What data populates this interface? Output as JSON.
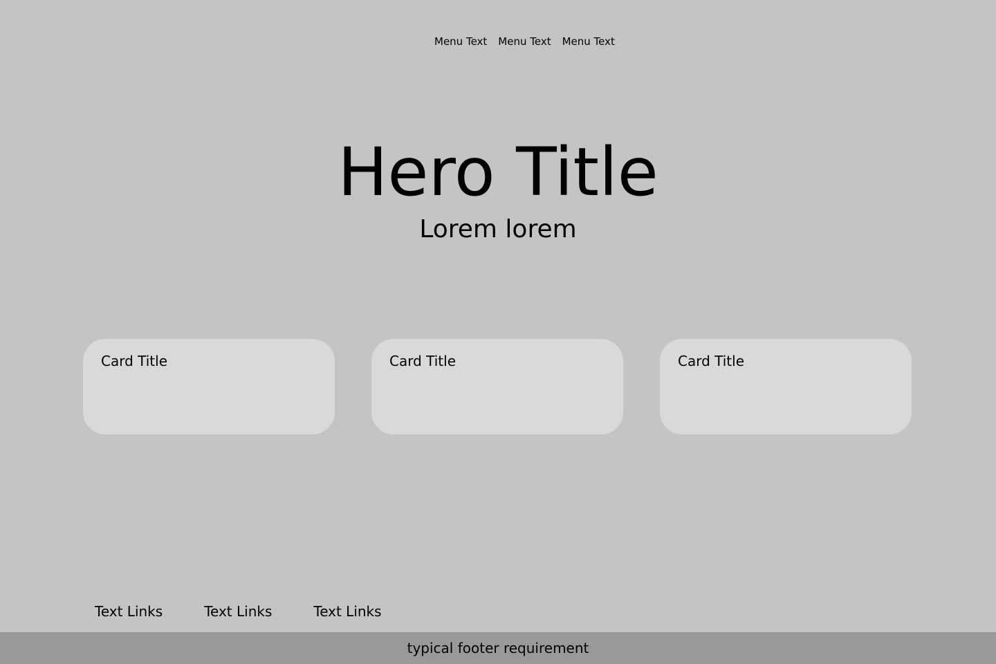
{
  "header": {
    "menu": [
      {
        "label": "Menu Text"
      },
      {
        "label": "Menu Text"
      },
      {
        "label": "Menu Text"
      }
    ]
  },
  "hero": {
    "title": "Hero Title",
    "subtitle": "Lorem lorem"
  },
  "cards": [
    {
      "title": "Card Title"
    },
    {
      "title": "Card Title"
    },
    {
      "title": "Card Title"
    }
  ],
  "footer": {
    "links": [
      {
        "label": "Text Links"
      },
      {
        "label": "Text Links"
      },
      {
        "label": "Text Links"
      }
    ],
    "bar_text": "typical footer requirement"
  },
  "colors": {
    "background": "#c4c4c4",
    "card": "#d9d9d9",
    "footer_bar": "#999999",
    "text": "#000000"
  }
}
